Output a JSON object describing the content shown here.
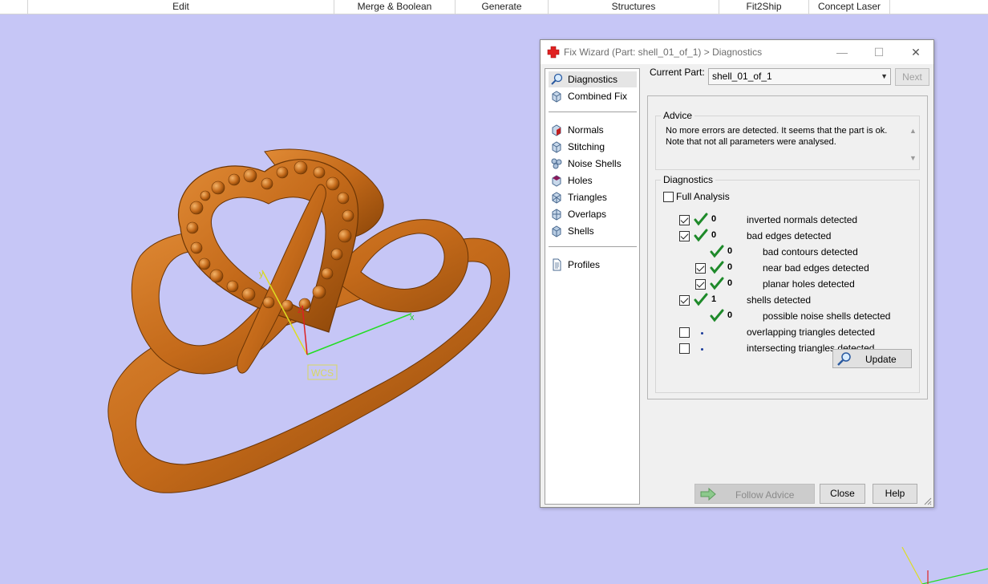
{
  "menubar": {
    "items": [
      "Edit",
      "Merge & Boolean",
      "Generate",
      "Structures",
      "Fit2Ship",
      "Concept Laser"
    ]
  },
  "viewport": {
    "axis_x_label": "x",
    "axis_y_label": "y",
    "axis_z_label": "z",
    "wcs_label": "WCS",
    "model_color": "#c46a1a",
    "background": "#c6c6f6"
  },
  "dialog": {
    "title": "Fix Wizard (Part: shell_01_of_1) > Diagnostics",
    "title_icon": "red-cross-icon",
    "nav": {
      "top": [
        {
          "label": "Diagnostics",
          "icon": "magnifier-icon",
          "selected": true
        },
        {
          "label": "Combined Fix",
          "icon": "cube-icon",
          "selected": false
        }
      ],
      "middle": [
        {
          "label": "Normals",
          "icon": "normals-cube-icon"
        },
        {
          "label": "Stitching",
          "icon": "stitching-cube-icon"
        },
        {
          "label": "Noise Shells",
          "icon": "noise-shells-icon"
        },
        {
          "label": "Holes",
          "icon": "holes-cube-icon"
        },
        {
          "label": "Triangles",
          "icon": "triangles-cube-icon"
        },
        {
          "label": "Overlaps",
          "icon": "overlaps-cube-icon"
        },
        {
          "label": "Shells",
          "icon": "shells-cube-icon"
        }
      ],
      "bottom": [
        {
          "label": "Profiles",
          "icon": "document-icon"
        }
      ]
    },
    "current_part_label": "Current Part:",
    "current_part_value": "shell_01_of_1",
    "next_label": "Next",
    "advice": {
      "title": "Advice",
      "line1": "No more errors are detected. It seems that the part is ok.",
      "line2": "Note that not all parameters were analysed."
    },
    "diagnostics": {
      "title": "Diagnostics",
      "full_analysis_label": "Full Analysis",
      "full_analysis_checked": false,
      "rows": [
        {
          "checkbox": true,
          "checked": true,
          "status": "ok",
          "count": "0",
          "label": "inverted normals detected",
          "indent": 0
        },
        {
          "checkbox": true,
          "checked": true,
          "status": "ok",
          "count": "0",
          "label": "bad edges detected",
          "indent": 0
        },
        {
          "checkbox": false,
          "checked": false,
          "status": "ok",
          "count": "0",
          "label": "bad contours detected",
          "indent": 1
        },
        {
          "checkbox": true,
          "checked": true,
          "status": "ok",
          "count": "0",
          "label": "near bad edges detected",
          "indent": 1
        },
        {
          "checkbox": true,
          "checked": true,
          "status": "ok",
          "count": "0",
          "label": "planar holes detected",
          "indent": 1
        },
        {
          "checkbox": true,
          "checked": true,
          "status": "ok",
          "count": "1",
          "label": "shells detected",
          "indent": 0
        },
        {
          "checkbox": false,
          "checked": false,
          "status": "ok",
          "count": "0",
          "label": "possible noise shells detected",
          "indent": 1
        },
        {
          "checkbox": true,
          "checked": false,
          "status": "none",
          "count": "",
          "label": "overlapping triangles detected",
          "indent": 0
        },
        {
          "checkbox": true,
          "checked": false,
          "status": "none",
          "count": "",
          "label": "intersecting triangles detected",
          "indent": 0
        }
      ],
      "update_label": "Update"
    },
    "buttons": {
      "follow_advice": "Follow Advice",
      "close": "Close",
      "help": "Help"
    },
    "colors": {
      "check_green": "#1e8a2a",
      "dot_blue": "#1a3b9a"
    }
  }
}
